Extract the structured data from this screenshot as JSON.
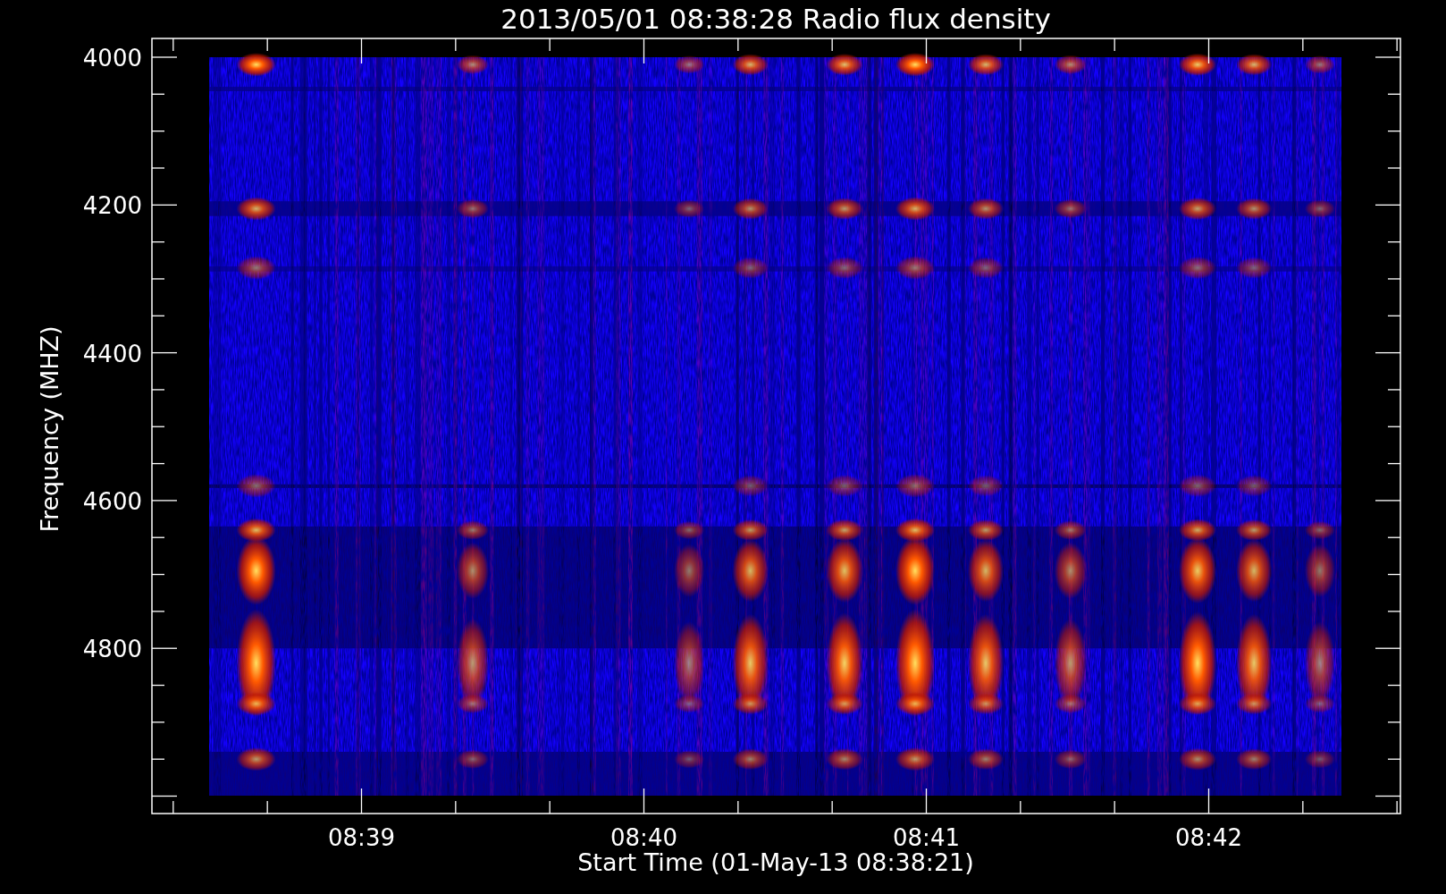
{
  "title": "2013/05/01 08:38:28 Radio flux density",
  "y_axis": {
    "label": "Frequency (MHZ)",
    "ticks": [
      "4000",
      "4200",
      "4400",
      "4600",
      "4800"
    ]
  },
  "x_axis": {
    "label": "Start Time (01-May-13 08:38:21)",
    "ticks": [
      "08:39",
      "08:40",
      "08:41",
      "08:42"
    ]
  }
}
